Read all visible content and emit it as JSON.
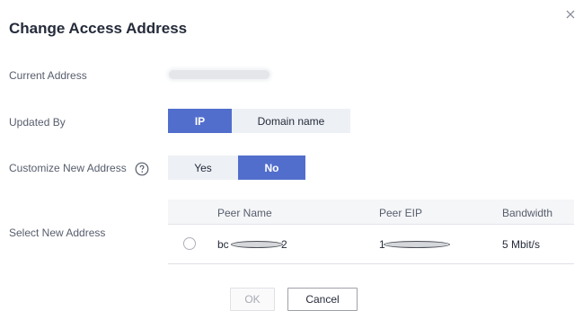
{
  "dialog": {
    "title": "Change Access Address",
    "close_icon": "close-icon"
  },
  "current_address": {
    "label": "Current Address",
    "value_masked": true
  },
  "updated_by": {
    "label": "Updated By",
    "options": [
      "IP",
      "Domain name"
    ],
    "selected": "IP"
  },
  "customize": {
    "label": "Customize New Address",
    "help_icon": "question-circle-icon",
    "options": [
      "Yes",
      "No"
    ],
    "selected": "No"
  },
  "select_address": {
    "label": "Select New Address",
    "columns": [
      "Peer Name",
      "Peer EIP",
      "Bandwidth"
    ],
    "rows": [
      {
        "peer_name_prefix": "bc",
        "peer_name_suffix": "2",
        "peer_eip_prefix": "1",
        "bandwidth": "5 Mbit/s",
        "selected": false
      }
    ]
  },
  "footer": {
    "ok_label": "OK",
    "cancel_label": "Cancel",
    "ok_enabled": false
  },
  "colors": {
    "accent": "#526ecc",
    "segment_off": "#edf0f5"
  }
}
